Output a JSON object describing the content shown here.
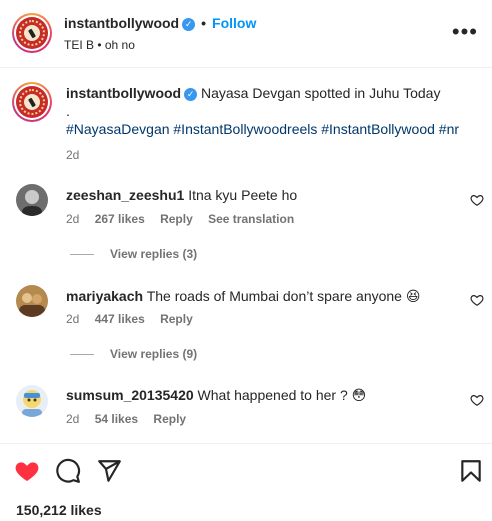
{
  "header": {
    "username": "instantbollywood",
    "follow_label": "Follow",
    "subtitle": "TEI B • oh no",
    "more_label": "•••"
  },
  "post": {
    "username": "instantbollywood",
    "caption": "Nayasa Devgan spotted in Juhu Today",
    "caption_dot": ".",
    "hashtags": "#NayasaDevgan #InstantBollywoodreels #InstantBollywood #nr",
    "age": "2d"
  },
  "comments": [
    {
      "username": "zeeshan_zeeshu1",
      "text": "Itna kyu Peete ho",
      "age": "2d",
      "likes": "267 likes",
      "reply_label": "Reply",
      "translate_label": "See translation",
      "view_replies": "View replies (3)"
    },
    {
      "username": "mariyakach",
      "text": "The roads of Mumbai don’t spare anyone 😆",
      "age": "2d",
      "likes": "447 likes",
      "reply_label": "Reply",
      "view_replies": "View replies (9)"
    },
    {
      "username": "sumsum_20135420",
      "text": "What happened to her ? 😳",
      "age": "2d",
      "likes": "54 likes",
      "reply_label": "Reply"
    }
  ],
  "footer": {
    "likes_total": "150,212 likes"
  },
  "colors": {
    "accent": "#0095f6",
    "like_red": "#ff3040",
    "hashtag": "#00376b"
  }
}
